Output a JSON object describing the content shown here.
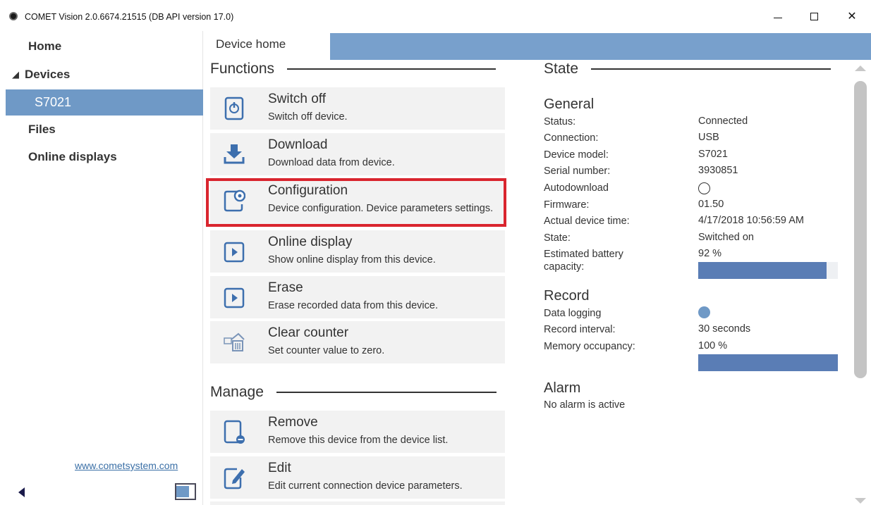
{
  "window": {
    "title": "COMET Vision 2.0.6674.21515 (DB API version 17.0)",
    "icon": "comet-app-icon",
    "controls": [
      "minimize",
      "maximize",
      "close"
    ]
  },
  "sidebar": {
    "items": [
      {
        "label": "Home"
      },
      {
        "label": "Devices"
      },
      {
        "label": "S7021"
      },
      {
        "label": "Files"
      },
      {
        "label": "Online displays"
      }
    ],
    "link": "www.cometsystem.com",
    "accent": "#6f99c6"
  },
  "tabs": {
    "active": "Device home"
  },
  "functions": {
    "heading": "Functions",
    "items": [
      {
        "title": "Switch off",
        "desc": "Switch off device.",
        "icon": "power-icon"
      },
      {
        "title": "Download",
        "desc": "Download data from device.",
        "icon": "download-icon"
      },
      {
        "title": "Configuration",
        "desc": "Device configuration. Device parameters settings.",
        "icon": "device-settings-icon"
      },
      {
        "title": "Online display",
        "desc": "Show online display from this device.",
        "icon": "play-box-icon"
      },
      {
        "title": "Erase",
        "desc": "Erase recorded data from this device.",
        "icon": "play-box-icon"
      },
      {
        "title": "Clear counter",
        "desc": "Set counter value to zero.",
        "icon": "clear-counter-icon"
      }
    ],
    "highlight_color": "#d9252e"
  },
  "manage": {
    "heading": "Manage",
    "items": [
      {
        "title": "Remove",
        "desc": "Remove this device from the device list.",
        "icon": "device-remove-icon"
      },
      {
        "title": "Edit",
        "desc": "Edit current connection device parameters.",
        "icon": "device-edit-icon"
      }
    ]
  },
  "state": {
    "heading": "State",
    "general": {
      "heading": "General",
      "rows": [
        {
          "label": "Status:",
          "value": "Connected"
        },
        {
          "label": "Connection:",
          "value": "USB"
        },
        {
          "label": "Device model:",
          "value": "S7021"
        },
        {
          "label": "Serial number:",
          "value": "3930851"
        },
        {
          "label": "Autodownload",
          "value": ""
        },
        {
          "label": "Firmware:",
          "value": "01.50"
        },
        {
          "label": "Actual device time:",
          "value": "4/17/2018 10:56:59 AM"
        },
        {
          "label": "State:",
          "value": "Switched on"
        },
        {
          "label": "Estimated battery capacity:",
          "value": "92 %"
        }
      ],
      "autodownload_enabled": false,
      "battery_fraction": 0.92
    },
    "record": {
      "heading": "Record",
      "rows": [
        {
          "label": "Data logging",
          "value": ""
        },
        {
          "label": "Record interval:",
          "value": "30 seconds"
        },
        {
          "label": "Memory occupancy:",
          "value": "100 %"
        }
      ],
      "data_logging_enabled": true,
      "memory_fraction": 1.0
    },
    "alarm": {
      "heading": "Alarm",
      "text": "No alarm is active"
    },
    "bar_color": "#5a7db5"
  }
}
